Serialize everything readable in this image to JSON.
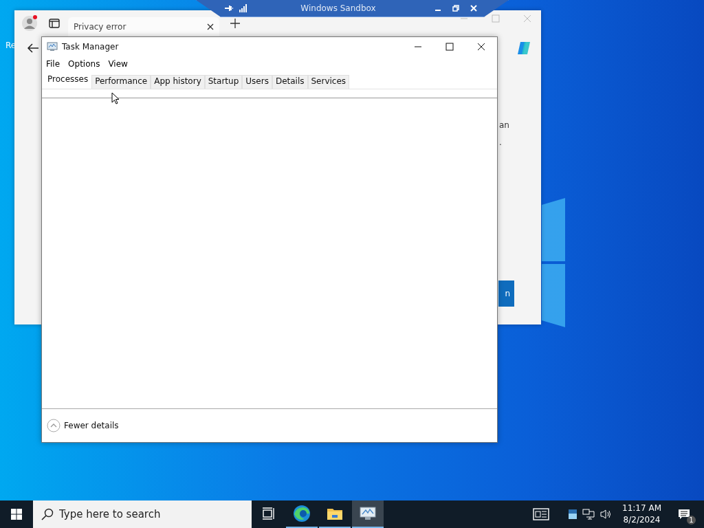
{
  "desktop": {
    "icon_label": "Re"
  },
  "sandbox_bar": {
    "title": "Windows Sandbox"
  },
  "browser": {
    "tab": {
      "title": "Privacy error"
    },
    "page_text": "an",
    "page_text_2": ".",
    "button_label": "n"
  },
  "task_manager": {
    "title": "Task Manager",
    "menu": [
      "File",
      "Options",
      "View"
    ],
    "tabs": [
      {
        "label": "Processes",
        "selected": true
      },
      {
        "label": "Performance",
        "selected": false
      },
      {
        "label": "App history",
        "selected": false
      },
      {
        "label": "Startup",
        "selected": false
      },
      {
        "label": "Users",
        "selected": false
      },
      {
        "label": "Details",
        "selected": false
      },
      {
        "label": "Services",
        "selected": false
      }
    ],
    "footer_link": "Fewer details"
  },
  "taskbar": {
    "search_placeholder": "Type here to search",
    "apps": [
      {
        "kind": "task-view",
        "running": false,
        "selected": false
      },
      {
        "kind": "browser",
        "running": true,
        "selected": false
      },
      {
        "kind": "folder",
        "running": true,
        "selected": false
      },
      {
        "kind": "monitor",
        "running": true,
        "selected": true
      }
    ],
    "time": "11:17 AM",
    "date": "8/2/2024",
    "notification_count": "1"
  }
}
